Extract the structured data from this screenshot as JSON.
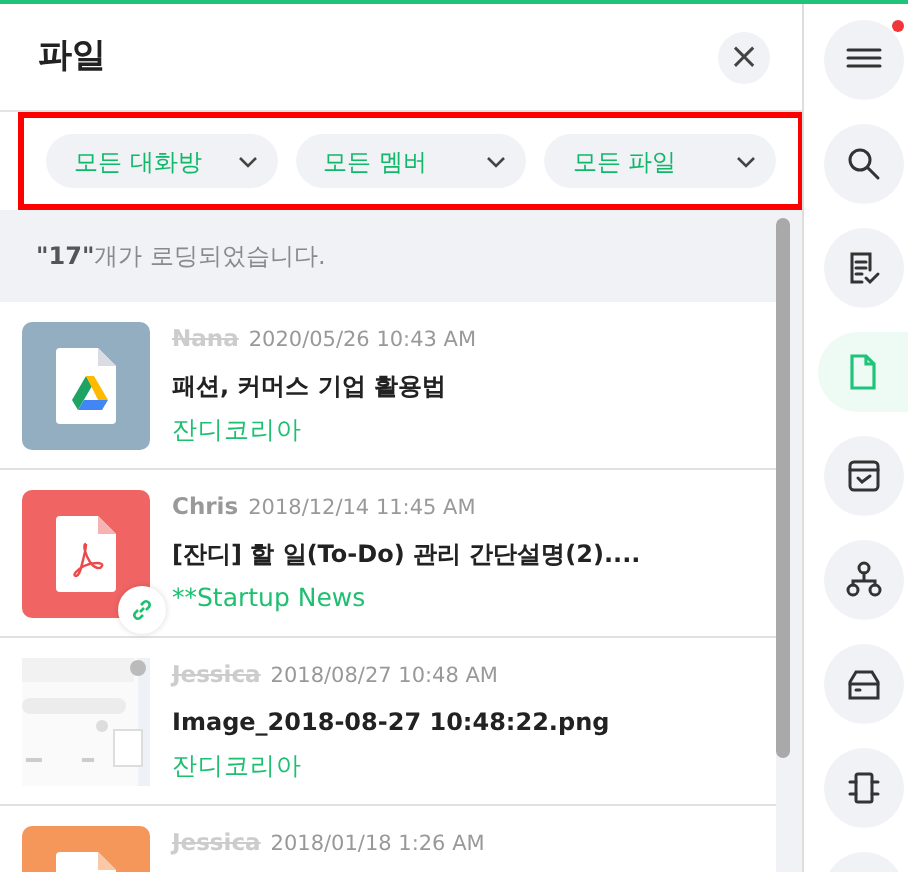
{
  "panel": {
    "title": "파일",
    "close": "×"
  },
  "filters": {
    "highlighted": true,
    "items": [
      {
        "label": "모든 대화방"
      },
      {
        "label": "모든 멤버"
      },
      {
        "label": "모든 파일"
      }
    ]
  },
  "status": "**\"17\"**개가 로딩되었습니다.",
  "files": [
    {
      "kind": "gdrive",
      "author": "Nana",
      "author_deleted": true,
      "time": "2020/05/26 10:43 AM",
      "name": "패션, 커머스 기업 활용법",
      "room": "잔디코리아",
      "linked": false
    },
    {
      "kind": "pdf",
      "author": "Chris",
      "author_deleted": false,
      "time": "2018/12/14 11:45 AM",
      "name": "[잔디] 할 일(To-Do) 관리 간단설명(2)....",
      "room": "**Startup News",
      "linked": true
    },
    {
      "author": "Jessica",
      "author_deleted": true,
      "time": "2018/08/27 10:48 AM",
      "name": "Image_2018-08-27 10:48:22.png",
      "room": "잔디코리아",
      "linked": false
    },
    {
      "kind": "file",
      "author": "Jessica",
      "author_deleted": true,
      "time": "2018/01/18 1:26 AM",
      "linked": false
    }
  ],
  "sidebar": [
    {
      "selected": false,
      "alert": true
    },
    {
      "selected": false,
      "alert": false
    },
    {
      "selected": false,
      "alert": false
    },
    {
      "selected": true,
      "alert": false
    },
    {
      "selected": false,
      "alert": false
    },
    {
      "selected": false,
      "alert": false
    },
    {
      "selected": false,
      "alert": false
    },
    {
      "selected": false,
      "alert": false
    },
    {
      "selected": false,
      "alert": false
    }
  ]
}
